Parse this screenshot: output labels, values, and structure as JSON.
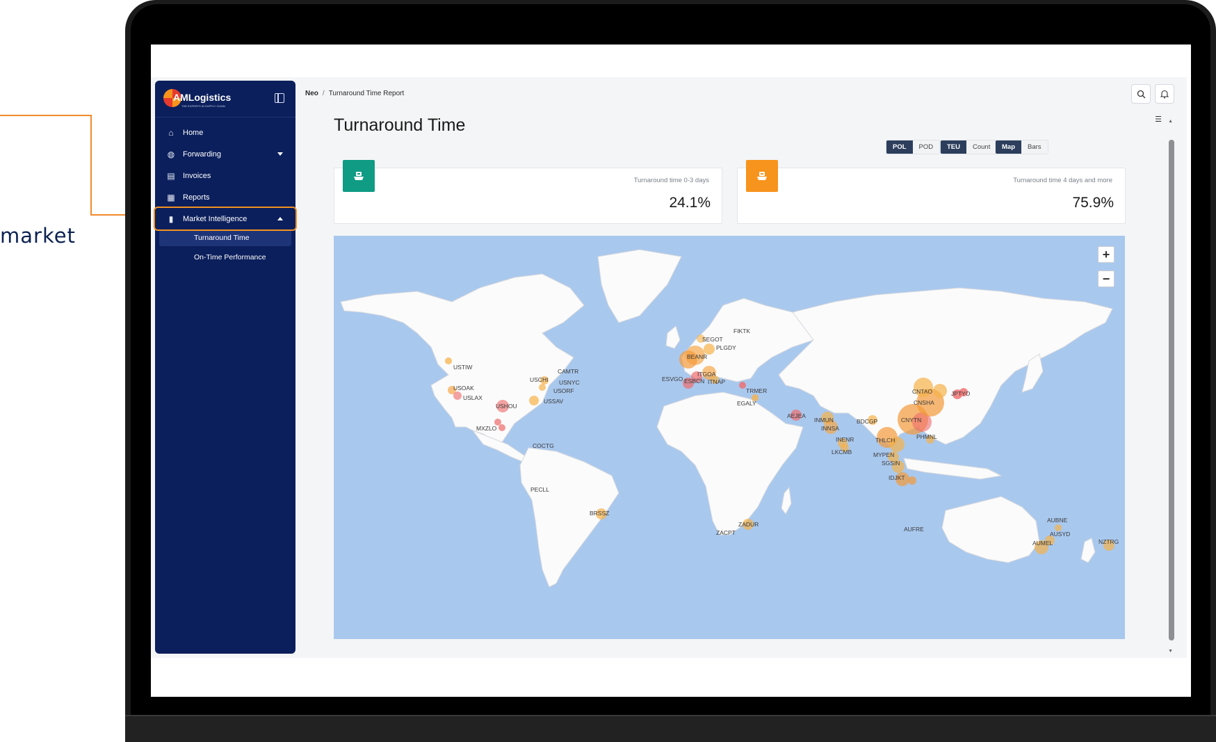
{
  "callout": {
    "text": "market"
  },
  "sidebar": {
    "brand": "AMLogistics",
    "tagline": "THE EXPERTS IN SUPPLY CHAIN",
    "items": [
      {
        "label": "Home",
        "icon": "home-icon"
      },
      {
        "label": "Forwarding",
        "icon": "globe-icon"
      },
      {
        "label": "Invoices",
        "icon": "invoice-icon"
      },
      {
        "label": "Reports",
        "icon": "report-icon"
      },
      {
        "label": "Market Intelligence",
        "icon": "bar-chart-icon"
      }
    ],
    "subitems": [
      {
        "label": "Turnaround Time"
      },
      {
        "label": "On-Time Performance"
      }
    ]
  },
  "breadcrumb": {
    "root": "Neo",
    "sep": "/",
    "current": "Turnaround Time Report"
  },
  "page": {
    "title": "Turnaround Time"
  },
  "toggles": {
    "port": {
      "options": [
        "POL",
        "POD"
      ],
      "selected": "POL"
    },
    "unit": {
      "options": [
        "TEU",
        "Count"
      ],
      "selected": "TEU"
    },
    "view": {
      "options": [
        "Map",
        "Bars"
      ],
      "selected": "Map"
    }
  },
  "kpis": [
    {
      "label": "Turnaround time 0-3 days",
      "value": "24.1%",
      "color": "#0f9b84"
    },
    {
      "label": "Turnaround time 4 days and more",
      "value": "75.9%",
      "color": "#f7941d"
    }
  ],
  "map": {
    "zoom_in": "+",
    "zoom_out": "−",
    "ports": [
      "USTIW",
      "USOAK",
      "USLAX",
      "USCHI",
      "CAMTR",
      "USNYC",
      "USORF",
      "USSAV",
      "USHOU",
      "MXZLO",
      "COCTG",
      "PECLL",
      "BRSSZ",
      "SEGOT",
      "FIKTK",
      "PLGDY",
      "BEANR",
      "ESVGO",
      "ESBCN",
      "ITGOA",
      "ITNAP",
      "TRMER",
      "EGALY",
      "AEJEA",
      "INMUN",
      "INNSA",
      "INENR",
      "LKCMB",
      "BDCGP",
      "THLCH",
      "MYPEN",
      "SGSIN",
      "IDJKT",
      "PHMNL",
      "CNYTN",
      "CNSHA",
      "CNTAO",
      "JPTYO",
      "ZADUR",
      "ZACPT",
      "AUFRE",
      "AUBNE",
      "AUSYD",
      "AUMEL",
      "NZTRG"
    ]
  }
}
